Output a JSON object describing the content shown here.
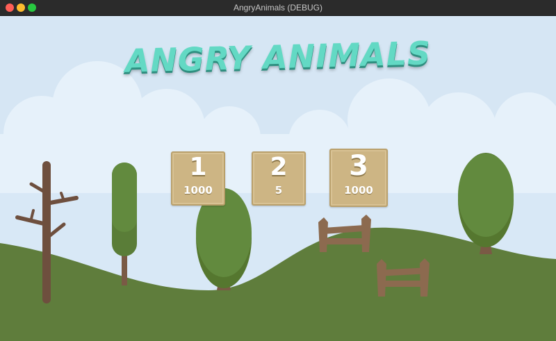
{
  "window": {
    "title": "AngryAnimals (DEBUG)"
  },
  "game": {
    "title": "ANGRY ANIMALS",
    "levels": [
      {
        "number": "1",
        "score": "1000"
      },
      {
        "number": "2",
        "score": "5"
      },
      {
        "number": "3",
        "score": "1000"
      }
    ]
  },
  "colors": {
    "sky": "#d6e6f4",
    "clouds": "#e6f1fa",
    "hill": "#5f7d3c",
    "tree_foliage": "#5f843d",
    "trunk": "#7a5a45",
    "title_text": "#63d9c4",
    "level_tile": "#cdb584"
  }
}
